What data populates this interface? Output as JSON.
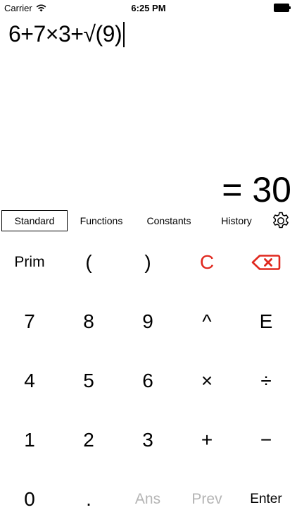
{
  "status_bar": {
    "carrier": "Carrier",
    "time": "6:25 PM",
    "icons": [
      "wifi-icon",
      "battery-icon"
    ]
  },
  "display": {
    "expression": "6+7×3+√(9)",
    "result": "= 30"
  },
  "tabs": [
    {
      "label": "Standard",
      "active": true
    },
    {
      "label": "Functions",
      "active": false
    },
    {
      "label": "Constants",
      "active": false
    },
    {
      "label": "History",
      "active": false
    }
  ],
  "settings_icon": "gear-icon",
  "keypad": {
    "rows": [
      [
        "Prim",
        "(",
        ")",
        "C",
        "backspace"
      ],
      [
        "7",
        "8",
        "9",
        "^",
        "E"
      ],
      [
        "4",
        "5",
        "6",
        "×",
        "÷"
      ],
      [
        "1",
        "2",
        "3",
        "+",
        "−"
      ],
      [
        "0",
        ".",
        "Ans",
        "Prev",
        "Enter"
      ]
    ],
    "accent_color": "#e0281e",
    "disabled_color": "#b4b4b4"
  }
}
